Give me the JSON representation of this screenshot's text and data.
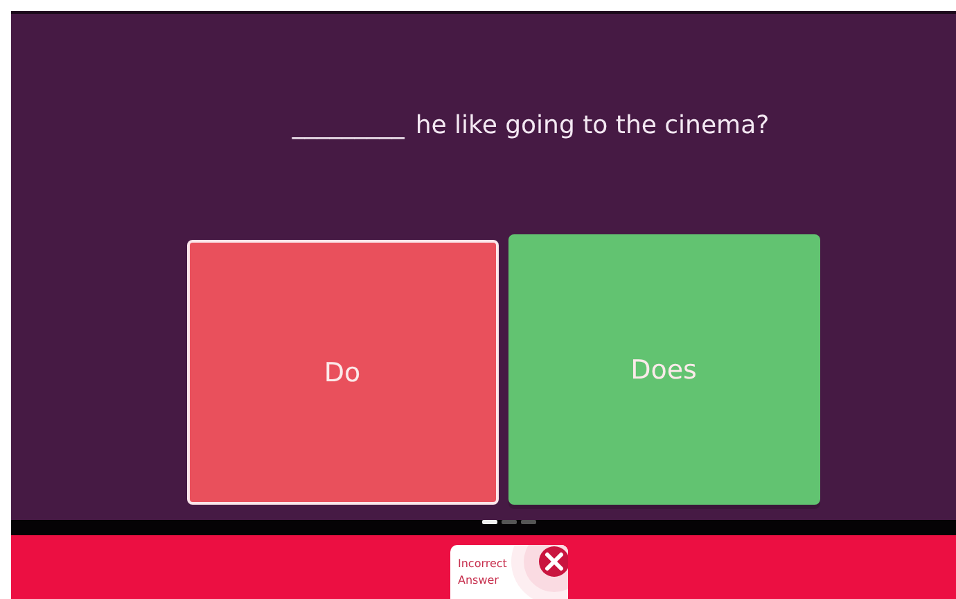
{
  "question": {
    "blank": "_________",
    "text": "he like going to the cinema?"
  },
  "options": [
    {
      "label": "Do",
      "kind": "incorrect",
      "selected": true
    },
    {
      "label": "Does",
      "kind": "correct",
      "selected": false
    }
  ],
  "pager": [
    {
      "selected": true
    },
    {
      "selected": false
    },
    {
      "selected": false
    }
  ],
  "feedback": {
    "text": "Incorrect Answer",
    "kind": "incorrect"
  }
}
